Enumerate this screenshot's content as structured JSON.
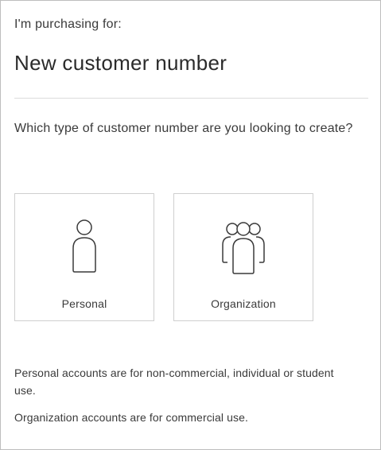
{
  "header": {
    "eyebrow": "I'm purchasing for:",
    "title": "New customer number"
  },
  "question": "Which type of customer number are you looking to create?",
  "options": [
    {
      "label": "Personal",
      "icon": "person-icon"
    },
    {
      "label": "Organization",
      "icon": "group-icon"
    }
  ],
  "notes": [
    "Personal accounts are for non-commercial, individual or student use.",
    "Organization accounts are for commercial use."
  ],
  "colors": {
    "text": "#2b2b2b",
    "border": "#cfcfcf",
    "icon_stroke": "#3a3a3a"
  }
}
